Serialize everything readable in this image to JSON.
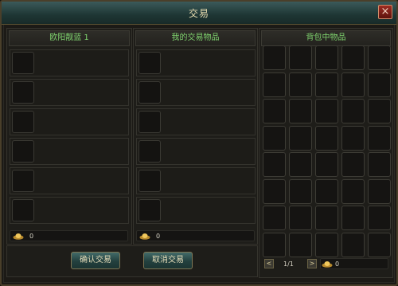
{
  "window": {
    "title": "交易",
    "close_symbol": "×"
  },
  "partner": {
    "title": "欧阳靓蓝 1",
    "gold": "0"
  },
  "mine": {
    "title": "我的交易物品",
    "gold": "0"
  },
  "bag": {
    "title": "背包中物品",
    "page": "1/1",
    "gold": "0",
    "prev_symbol": "<",
    "next_symbol": ">"
  },
  "buttons": {
    "confirm": "确认交易",
    "cancel": "取消交易"
  },
  "layout": {
    "trade_slots_per_side": 6,
    "bag_grid_cols": 5,
    "bag_grid_rows": 8
  }
}
